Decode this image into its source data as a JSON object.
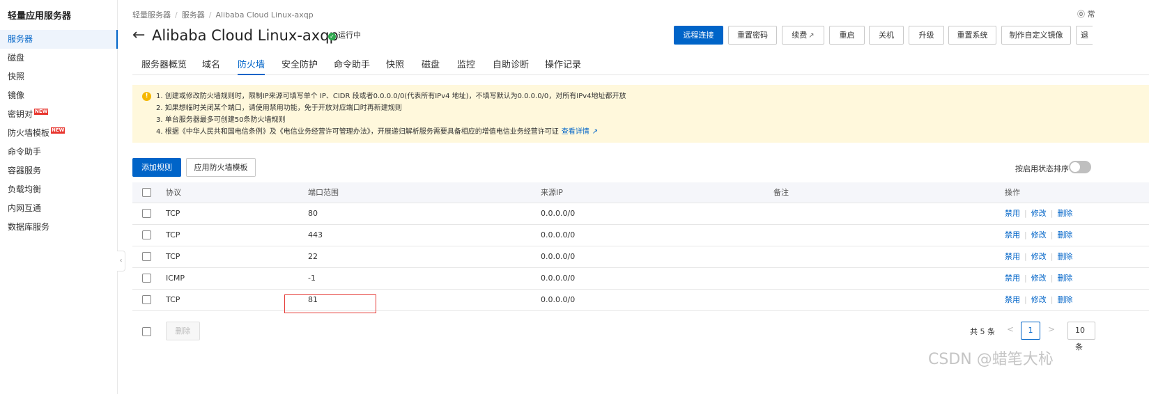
{
  "sidebar": {
    "title": "轻量应用服务器",
    "items": [
      {
        "label": "服务器",
        "active": true
      },
      {
        "label": "磁盘"
      },
      {
        "label": "快照"
      },
      {
        "label": "镜像"
      },
      {
        "label": "密钥对",
        "badge": "NEW"
      },
      {
        "label": "防火墙模板",
        "badge": "NEW"
      },
      {
        "label": "命令助手"
      },
      {
        "label": "容器服务"
      },
      {
        "label": "负载均衡"
      },
      {
        "label": "内网互通"
      },
      {
        "label": "数据库服务"
      }
    ],
    "collapse_glyph": "‹"
  },
  "breadcrumb": [
    "轻量服务器",
    "服务器",
    "Alibaba Cloud Linux-axqp"
  ],
  "help_text": "⓪ 常",
  "header": {
    "back_glyph": "←",
    "title": "Alibaba Cloud Linux-axqp",
    "status": "运行中",
    "status_color": "#2fa84f",
    "buttons": {
      "remote": "远程连接",
      "reset_pwd": "重置密码",
      "renew": "续费",
      "restart": "重启",
      "shutdown": "关机",
      "upgrade": "升级",
      "reset_sys": "重置系统",
      "custom_image": "制作自定义镜像",
      "more": "退"
    }
  },
  "tabs": [
    "服务器概览",
    "域名",
    "防火墙",
    "安全防护",
    "命令助手",
    "快照",
    "磁盘",
    "监控",
    "自助诊断",
    "操作记录"
  ],
  "active_tab": "防火墙",
  "notice": {
    "lines": [
      "1. 创建或修改防火墙规则时，限制IP来源可填写单个 IP、CIDR 段或者0.0.0.0/0(代表所有IPv4 地址)，不填写默认为0.0.0.0/0，对所有IPv4地址都开放",
      "2. 如果想临时关闭某个端口，请使用禁用功能，免于开放对应端口时再新建规则",
      "3. 单台服务器最多可创建50条防火墙规则",
      "4. 根据《中华人民共和国电信条例》及《电信业务经营许可管理办法》，开展递归解析服务需要具备相应的增值电信业务经营许可证"
    ],
    "link": "查看详情"
  },
  "actions": {
    "add_rule": "添加规则",
    "apply_template": "应用防火墙模板",
    "sort_label": "按启用状态排序"
  },
  "table": {
    "headers": {
      "protocol": "协议",
      "port": "端口范围",
      "source": "来源IP",
      "note": "备注",
      "ops": "操作"
    },
    "rows": [
      {
        "protocol": "TCP",
        "port": "80",
        "source": "0.0.0.0/0",
        "note": ""
      },
      {
        "protocol": "TCP",
        "port": "443",
        "source": "0.0.0.0/0",
        "note": ""
      },
      {
        "protocol": "TCP",
        "port": "22",
        "source": "0.0.0.0/0",
        "note": ""
      },
      {
        "protocol": "ICMP",
        "port": "-1",
        "source": "0.0.0.0/0",
        "note": ""
      },
      {
        "protocol": "TCP",
        "port": "81",
        "source": "0.0.0.0/0",
        "note": ""
      }
    ],
    "ops": {
      "disable": "禁用",
      "edit": "修改",
      "delete": "删除"
    }
  },
  "footer": {
    "delete": "删除",
    "total": "共 5 条",
    "prev": "<",
    "page": "1",
    "next": ">",
    "page_size": "10 条"
  },
  "watermark": "CSDN @蜡笔大杺"
}
